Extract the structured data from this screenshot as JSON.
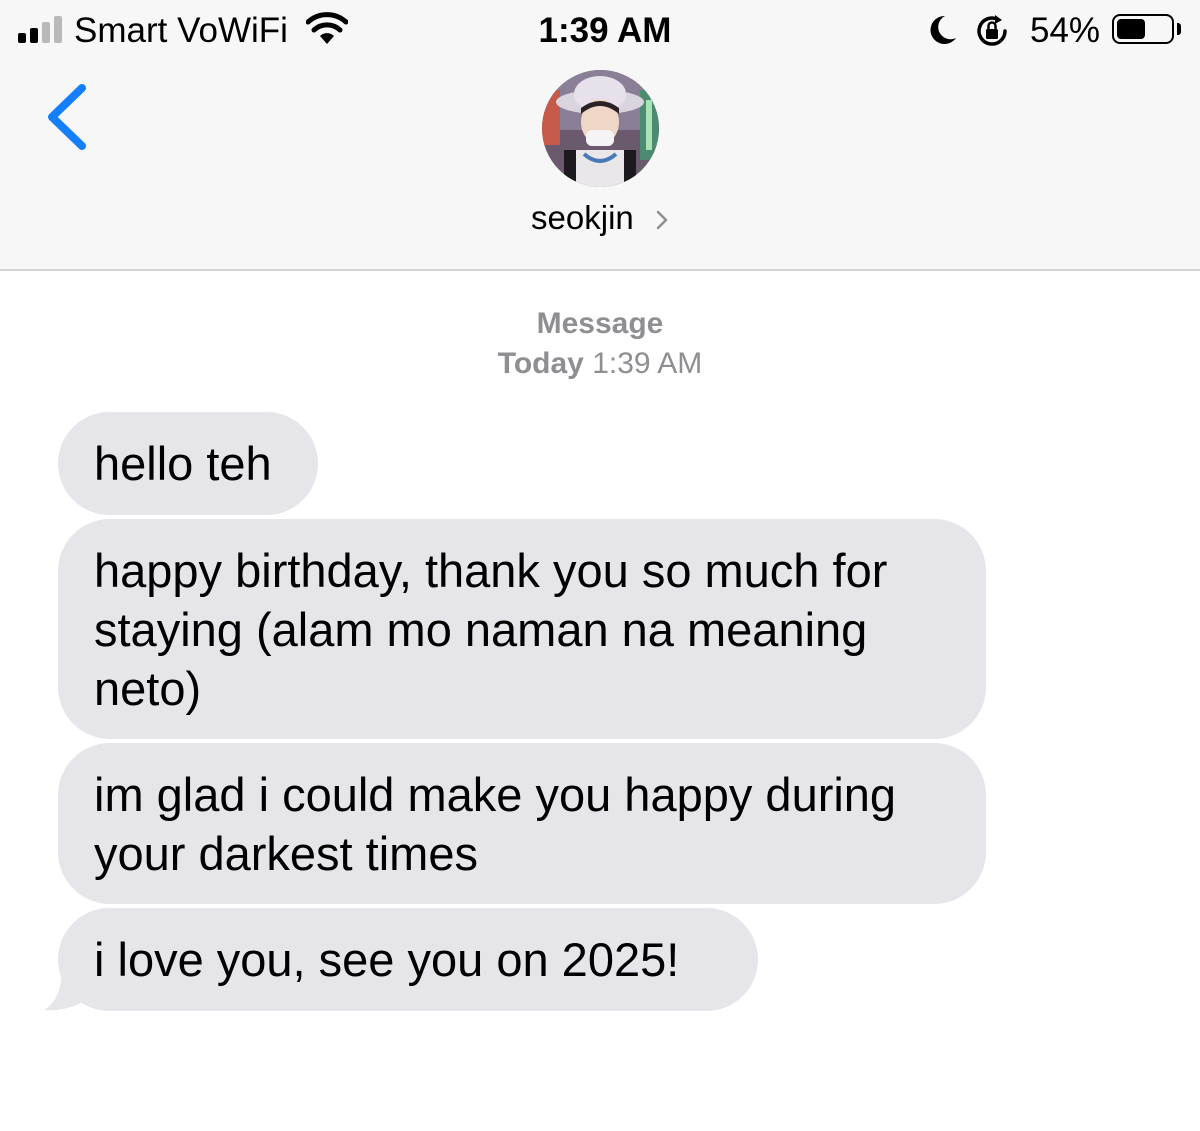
{
  "status_bar": {
    "carrier": "Smart VoWiFi",
    "time": "1:39 AM",
    "battery_percent_label": "54%",
    "battery_level": 0.54,
    "signal_bars_filled": 2,
    "signal_bars_total": 4,
    "icons": [
      "signal-bars",
      "wifi-icon",
      "moon-icon",
      "orientation-lock-icon",
      "battery-icon"
    ]
  },
  "header": {
    "contact_name": "seokjin",
    "back_icon": "chevron-left-icon",
    "details_icon": "chevron-right-icon"
  },
  "thread": {
    "service_label": "Message",
    "date_day": "Today",
    "date_time": "1:39 AM",
    "messages": [
      {
        "text": "hello teh",
        "direction": "incoming"
      },
      {
        "text": "happy birthday, thank you so much for\nstaying (alam mo naman na meaning\nneto)",
        "direction": "incoming"
      },
      {
        "text": "im glad i could make you happy during\nyour darkest times",
        "direction": "incoming"
      },
      {
        "text": "i love you, see you on 2025!",
        "direction": "incoming"
      }
    ]
  },
  "colors": {
    "accent": "#147efb",
    "incoming_bubble": "#e5e5ea",
    "header_bg": "#f7f7f7",
    "meta_text": "#8e8e93"
  }
}
